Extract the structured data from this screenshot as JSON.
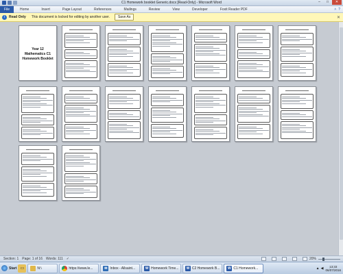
{
  "window": {
    "title": "C1 Homework booklet Generic.docx [Read-Only] - Microsoft Word",
    "controls": {
      "minimize": "–",
      "maximize": "□",
      "close": "✕"
    }
  },
  "ribbon": {
    "file": "File",
    "tabs": [
      "Home",
      "Insert",
      "Page Layout",
      "References",
      "Mailings",
      "Review",
      "View",
      "Developer",
      "Foxit Reader PDF"
    ]
  },
  "message_bar": {
    "badge": "Read Only",
    "text": "This document is locked for editing by another user.",
    "button": "Save As",
    "close": "✕"
  },
  "document": {
    "cover_title_line1": "Year 12 Mathematics C1",
    "cover_title_line2": "Homework Booklet"
  },
  "status_bar": {
    "section": "Section: 1",
    "page": "Page: 1 of 16",
    "words": "Words: 111",
    "zoom": "20%"
  },
  "taskbar": {
    "start": "Start",
    "items": [
      {
        "label": "N:\\",
        "icon": "folder-icon"
      },
      {
        "label": "https://www.le...",
        "icon": "chrome-icon"
      },
      {
        "label": "Inbox - Allsaint...",
        "icon": "email-icon"
      },
      {
        "label": "Homework Time...",
        "icon": "word-icon"
      },
      {
        "label": "C2 Homework B...",
        "icon": "word-icon"
      },
      {
        "label": "C1 Homework...",
        "icon": "word-icon"
      }
    ],
    "time": "13:33",
    "date": "06/07/2016"
  }
}
